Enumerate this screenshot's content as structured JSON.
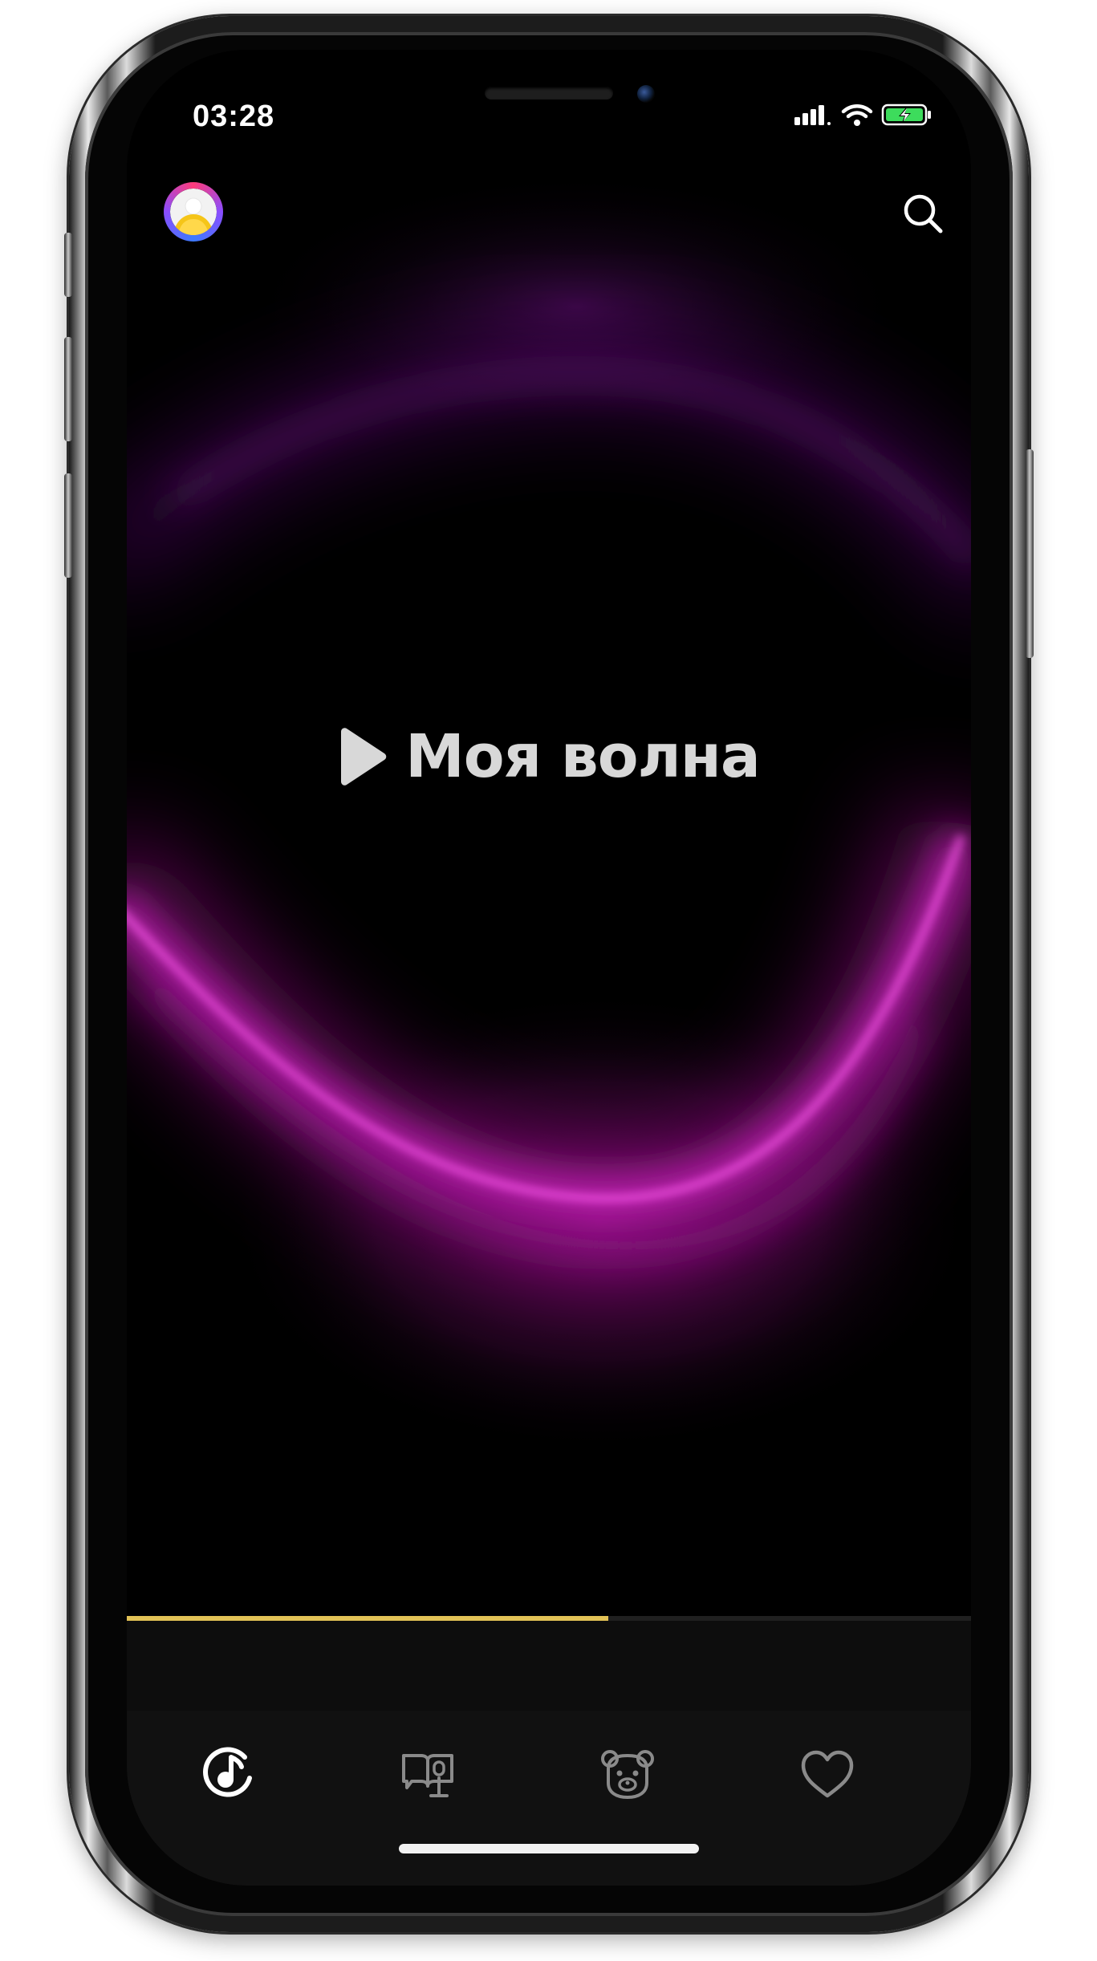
{
  "status_bar": {
    "time": "03:28",
    "icons": [
      "cellular-signal-icon",
      "wifi-icon",
      "battery-charging-icon"
    ],
    "battery_color": "#3ddc5c"
  },
  "header": {
    "avatar": "profile-avatar",
    "search_icon": "search-icon"
  },
  "wave": {
    "play_icon": "play-icon",
    "title": "Моя волна",
    "accent_color": "#e020d0"
  },
  "player": {
    "progress": 0.57,
    "progress_color": "#e2c256"
  },
  "tab_bar": {
    "tabs": [
      {
        "icon": "music-note-disc-icon",
        "active": true
      },
      {
        "icon": "podcasts-book-icon",
        "active": false
      },
      {
        "icon": "kids-bear-icon",
        "active": false
      },
      {
        "icon": "heart-icon",
        "active": false
      }
    ],
    "active_color": "#ffffff",
    "inactive_color": "#8a8a8a"
  }
}
